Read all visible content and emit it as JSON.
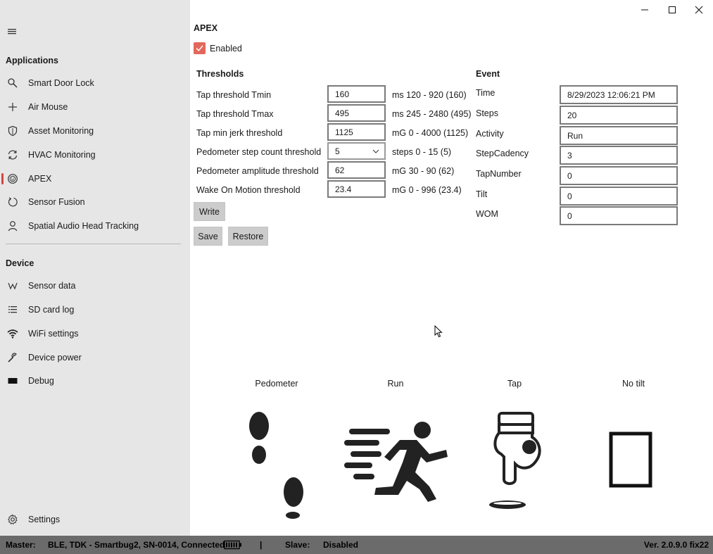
{
  "sidebar": {
    "applications_heading": "Applications",
    "applications": [
      {
        "label": "Smart Door Lock",
        "icon": "search-icon"
      },
      {
        "label": "Air Mouse",
        "icon": "plus-icon"
      },
      {
        "label": "Asset Monitoring",
        "icon": "shield-icon"
      },
      {
        "label": "HVAC Monitoring",
        "icon": "sync-icon"
      },
      {
        "label": "APEX",
        "icon": "smiley-icon",
        "selected": true
      },
      {
        "label": "Sensor Fusion",
        "icon": "refresh-icon"
      },
      {
        "label": "Spatial Audio Head Tracking",
        "icon": "person-icon"
      }
    ],
    "device_heading": "Device",
    "device": [
      {
        "label": "Sensor data",
        "icon": "sensor-icon"
      },
      {
        "label": "SD card log",
        "icon": "list-icon"
      },
      {
        "label": "WiFi settings",
        "icon": "wifi-icon"
      },
      {
        "label": "Device power",
        "icon": "wrench-icon"
      },
      {
        "label": "Debug",
        "icon": "terminal-icon"
      }
    ],
    "settings_label": "Settings"
  },
  "main": {
    "title": "APEX",
    "enabled_label": "Enabled",
    "enabled_checked": true,
    "thresholds_heading": "Thresholds",
    "thresholds": [
      {
        "label": "Tap threshold Tmin",
        "value": "160",
        "range": "ms  120 - 920 (160)"
      },
      {
        "label": "Tap threshold Tmax",
        "value": "495",
        "range": "ms  245 - 2480 (495)"
      },
      {
        "label": "Tap min jerk threshold",
        "value": "1125",
        "range": "mG  0 - 4000 (1125)"
      },
      {
        "label": "Pedometer step count threshold",
        "value": "5",
        "range": "steps  0 - 15 (5)",
        "dropdown": true
      },
      {
        "label": "Pedometer amplitude threshold",
        "value": "62",
        "range": "mG  30 - 90 (62)"
      },
      {
        "label": "Wake On Motion threshold",
        "value": "23.4",
        "range": "mG  0 - 996 (23.4)"
      }
    ],
    "write_label": "Write",
    "save_label": "Save",
    "restore_label": "Restore",
    "event_heading": "Event",
    "events": [
      {
        "label": "Time",
        "value": "8/29/2023 12:06:21 PM"
      },
      {
        "label": "Steps",
        "value": "20"
      },
      {
        "label": "Activity",
        "value": "Run"
      },
      {
        "label": "StepCadency",
        "value": "3"
      },
      {
        "label": "TapNumber",
        "value": "0"
      },
      {
        "label": "Tilt",
        "value": "0"
      },
      {
        "label": "WOM",
        "value": "0"
      }
    ],
    "indicators": [
      {
        "caption": "Pedometer",
        "icon": "footprints-icon"
      },
      {
        "caption": "Run",
        "icon": "runner-icon"
      },
      {
        "caption": "Tap",
        "icon": "tap-finger-icon"
      },
      {
        "caption": "No tilt",
        "icon": "tilt-frame-icon"
      }
    ]
  },
  "statusbar": {
    "master_label": "Master:",
    "master_value": "BLE, TDK - Smartbug2, SN-0014, Connected",
    "separator": "|",
    "slave_label": "Slave:",
    "slave_value": "Disabled",
    "version": "Ver. 2.0.9.0 fix22"
  },
  "colors": {
    "accent": "#e3685c",
    "sidebar_bg": "#e6e6e6",
    "statusbar_bg": "#6b6b6b",
    "button_bg": "#cccccc"
  }
}
